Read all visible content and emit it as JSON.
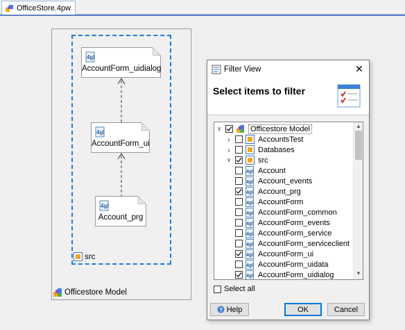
{
  "tab": {
    "title": "OfficeStore.4pw"
  },
  "diagram": {
    "nodes": [
      {
        "label": "AccountForm_uidialog"
      },
      {
        "label": "AccountForm_ui"
      },
      {
        "label": "Account_prg"
      }
    ],
    "src_label": "src",
    "model_label": "Officestore Model"
  },
  "dialog": {
    "title": "Filter View",
    "heading": "Select items to filter",
    "tree": [
      {
        "label": "Officestore Model",
        "checked": true,
        "icon": "model-icon",
        "expander": "expanded"
      },
      {
        "label": "AccountsTest",
        "checked": false,
        "icon": "folder-icon",
        "expander": "collapsed"
      },
      {
        "label": "Databases",
        "checked": false,
        "icon": "folder-icon",
        "expander": "collapsed"
      },
      {
        "label": "src",
        "checked": true,
        "icon": "folder-icon",
        "expander": "expanded"
      },
      {
        "label": "Account",
        "checked": false,
        "icon": "4gl-icon"
      },
      {
        "label": "Account_events",
        "checked": false,
        "icon": "4gl-icon"
      },
      {
        "label": "Account_prg",
        "checked": true,
        "icon": "4gl-icon"
      },
      {
        "label": "AccountForm",
        "checked": false,
        "icon": "4gl-icon"
      },
      {
        "label": "AccountForm_common",
        "checked": false,
        "icon": "4gl-icon"
      },
      {
        "label": "AccountForm_events",
        "checked": false,
        "icon": "4gl-icon"
      },
      {
        "label": "AccountForm_service",
        "checked": false,
        "icon": "4gl-icon"
      },
      {
        "label": "AccountForm_serviceclient",
        "checked": false,
        "icon": "4gl-icon"
      },
      {
        "label": "AccountForm_ui",
        "checked": true,
        "icon": "4gl-icon"
      },
      {
        "label": "AccountForm_uidata",
        "checked": false,
        "icon": "4gl-icon"
      },
      {
        "label": "AccountForm_uidialog",
        "checked": true,
        "icon": "4gl-icon"
      }
    ],
    "select_all_label": "Select all",
    "buttons": {
      "help": "Help",
      "ok": "OK",
      "cancel": "Cancel"
    }
  },
  "colors": {
    "selection_border": "#1f7bd8",
    "tab_accent": "#5d82c0",
    "primary_button": "#0078d7"
  }
}
